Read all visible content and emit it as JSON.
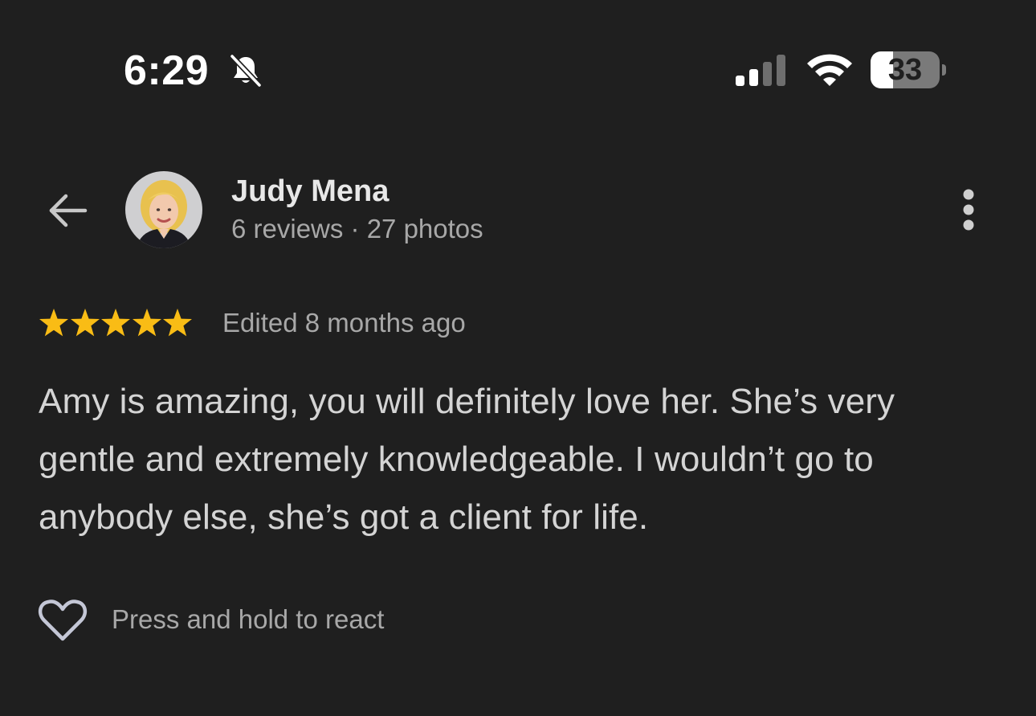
{
  "status_bar": {
    "time": "6:29",
    "silent_icon": "bell-slash-icon",
    "signal_icon": "cellular-signal-icon",
    "wifi_icon": "wifi-icon",
    "battery_percent": "33",
    "battery_level": 0.33
  },
  "header": {
    "back_icon": "arrow-left-icon",
    "reviewer_name": "Judy Mena",
    "reviewer_meta": "6 reviews · 27 photos",
    "more_icon": "more-vertical-icon"
  },
  "review": {
    "rating": 5,
    "max_rating": 5,
    "star_color": "#F9BC15",
    "edited": "Edited 8 months ago",
    "text": "Amy is amazing, you will definitely love her. She’s very gentle and extremely knowledgeable. I wouldn’t go to anybody else, she’s got a client for life."
  },
  "reactions": {
    "heart_icon": "heart-outline-icon",
    "hint": "Press and hold to react"
  },
  "colors": {
    "background": "#1F1F1F",
    "primary_text": "#E8E8E8",
    "secondary_text": "#A8A8A8",
    "heart_stroke": "#C4C7D6"
  }
}
